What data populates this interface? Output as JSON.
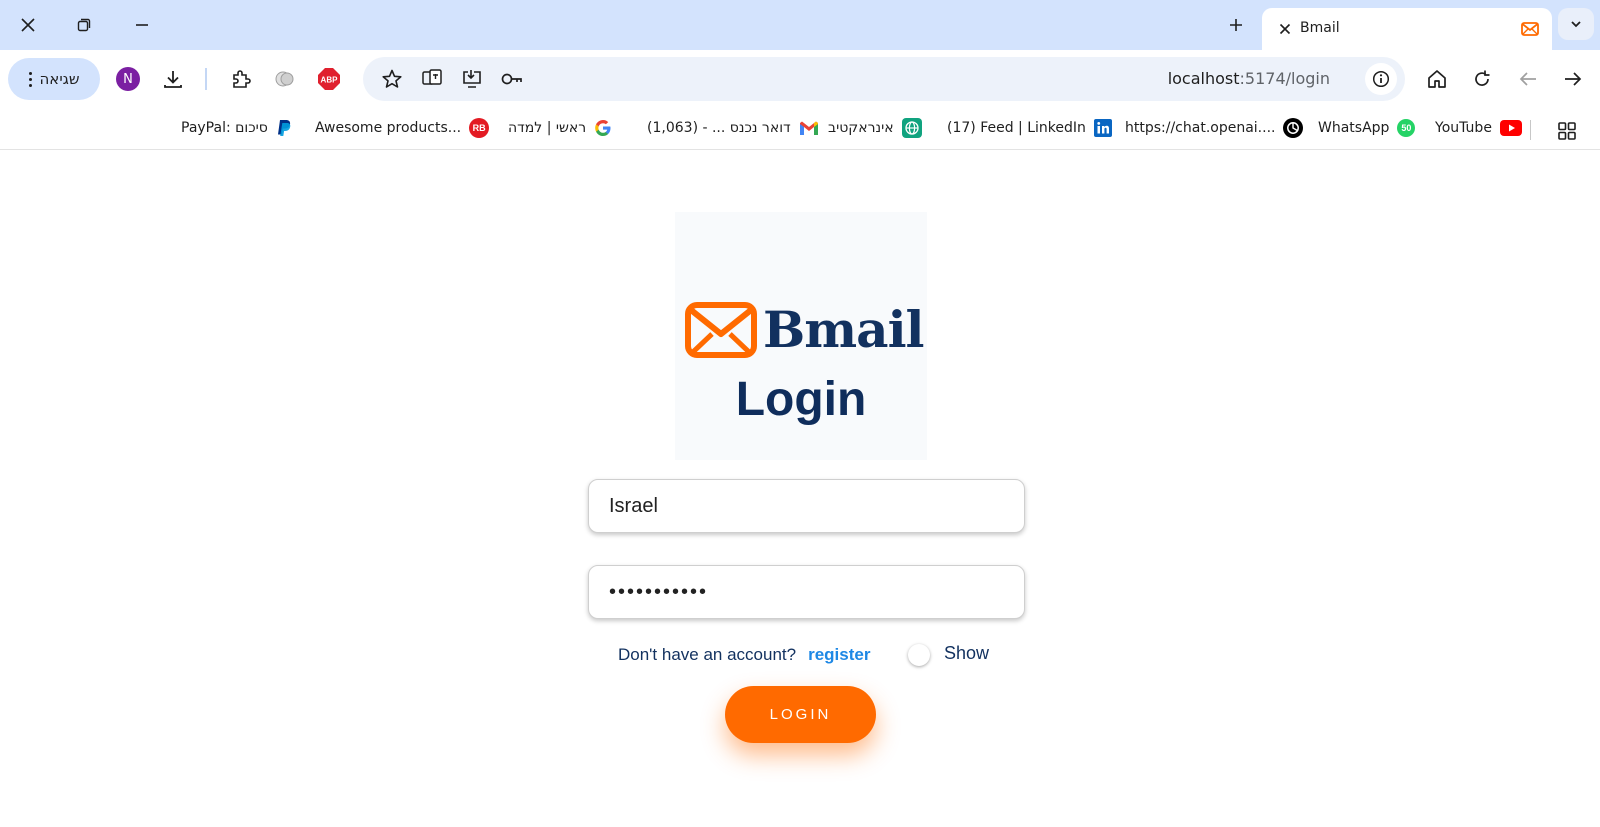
{
  "browser": {
    "tab": {
      "title": "Bmail",
      "close_glyph": "✕"
    },
    "new_tab_glyph": "+",
    "profile_initial": "N",
    "error_pill_label": "שגיאה",
    "url": {
      "host": "localhost",
      "path": ":5174/login"
    }
  },
  "bookmarks": [
    {
      "label": "YouTube",
      "icon": "youtube-icon",
      "color": "#ff0000"
    },
    {
      "label": "WhatsApp",
      "icon": "whatsapp-icon",
      "color": "#25d366",
      "badge": "50"
    },
    {
      "label": "https://chat.openai....",
      "icon": "openai-icon",
      "color": "#000000"
    },
    {
      "label": "(17) Feed | LinkedIn",
      "icon": "linkedin-icon",
      "color": "#0a66c2"
    },
    {
      "label": "אינראקטיב",
      "icon": "globe-icon",
      "color": "#10a37f"
    },
    {
      "label": "דואר נכנס ... - (1,063)",
      "icon": "gmail-icon",
      "color": "#ea4335"
    },
    {
      "label": "ראשי | למדה",
      "icon": "google-icon",
      "color": "#4285f4"
    },
    {
      "label": "Awesome products...",
      "icon": "rb-icon",
      "color": "#e31b23",
      "badge": "RB"
    },
    {
      "label": "PayPal: סיכום",
      "icon": "paypal-icon",
      "color": "#003087"
    }
  ],
  "page": {
    "brand_name": "Bmail",
    "heading": "Login",
    "username_value": "Israel",
    "password_value": "•••••••••••",
    "no_account_text": "Don't have an account?",
    "register_link": "register",
    "show_label": "Show",
    "login_button": "LOGIN"
  },
  "colors": {
    "accent_orange": "#ff6a00",
    "brand_navy": "#12315f",
    "link_blue": "#1e88e5",
    "tabstrip_bg": "#d3e3fd"
  }
}
